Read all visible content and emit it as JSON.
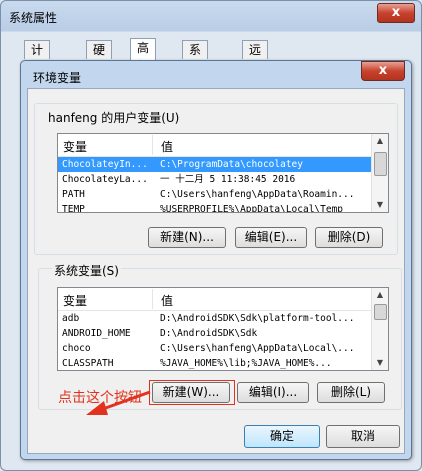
{
  "window": {
    "title": "系统属性",
    "close_label": "x"
  },
  "tabs": [
    "计算机名",
    "硬件",
    "高级",
    "系统保护",
    "远程"
  ],
  "dialog": {
    "title": "环境变量",
    "close_label": "x"
  },
  "user_vars": {
    "label": "hanfeng 的用户变量(U)",
    "col_var": "变量",
    "col_val": "值",
    "rows": [
      {
        "name": "ChocolateyIn...",
        "value": "C:\\ProgramData\\chocolatey"
      },
      {
        "name": "ChocolateyLa...",
        "value": "一 十二月  5 11:38:45 2016"
      },
      {
        "name": "PATH",
        "value": "C:\\Users\\hanfeng\\AppData\\Roamin..."
      },
      {
        "name": "TEMP",
        "value": "%USERPROFILE%\\AppData\\Local\\Temp"
      }
    ],
    "buttons": {
      "new": "新建(N)...",
      "edit": "编辑(E)...",
      "delete": "删除(D)"
    }
  },
  "sys_vars": {
    "label": "系统变量(S)",
    "col_var": "变量",
    "col_val": "值",
    "rows": [
      {
        "name": "adb",
        "value": "D:\\AndroidSDK\\Sdk\\platform-tool..."
      },
      {
        "name": "ANDROID_HOME",
        "value": "D:\\AndroidSDK\\Sdk"
      },
      {
        "name": "choco",
        "value": "C:\\Users\\hanfeng\\AppData\\Local\\..."
      },
      {
        "name": "CLASSPATH",
        "value": "   %JAVA_HOME%\\lib;%JAVA_HOME%..."
      }
    ],
    "buttons": {
      "new": "新建(W)...",
      "edit": "编辑(I)...",
      "delete": "删除(L)"
    }
  },
  "footer": {
    "ok": "确定",
    "cancel": "取消"
  },
  "annotation": {
    "text": "点击这个按钮",
    "color": "#e2321e"
  }
}
